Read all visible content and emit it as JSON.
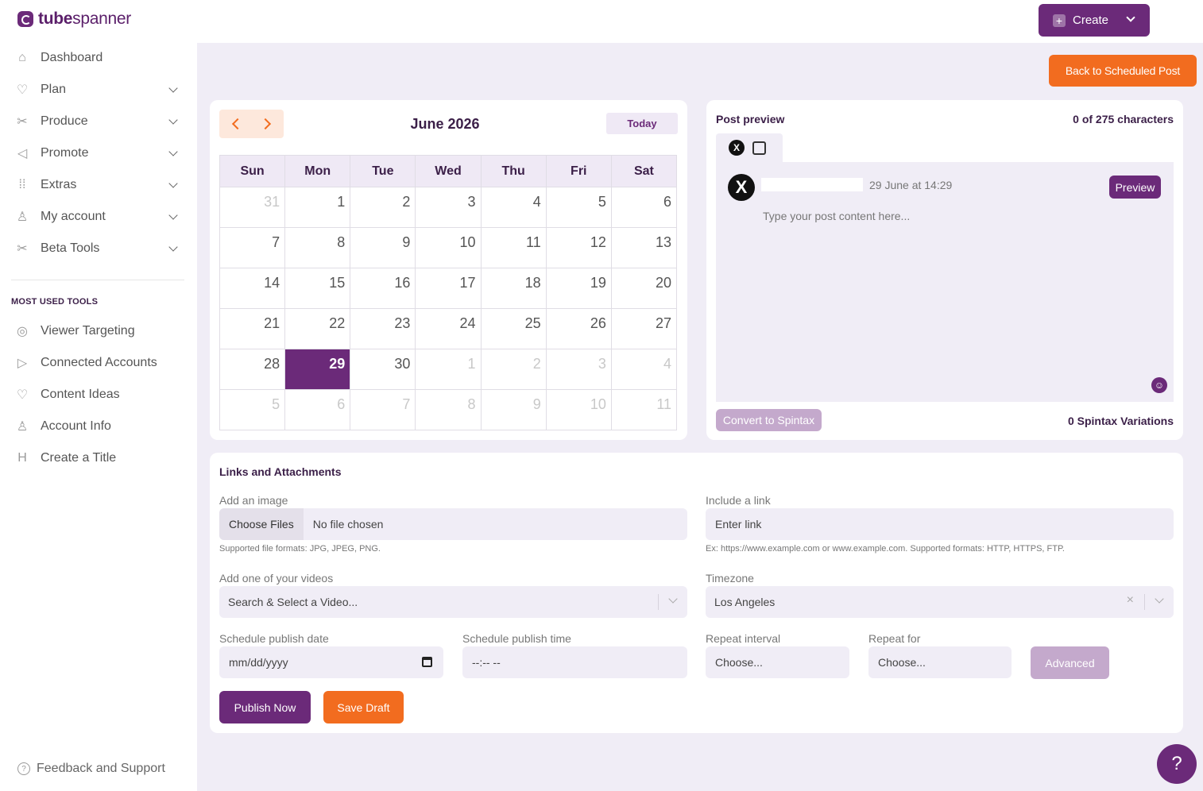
{
  "brand": {
    "name_bold": "tube",
    "name_rest": "spanner",
    "color": "#6b2a79",
    "accent": "#f26c1f"
  },
  "sidebar": {
    "items": [
      {
        "label": "Dashboard",
        "icon": "home-icon",
        "expandable": false
      },
      {
        "label": "Plan",
        "icon": "lightbulb-icon",
        "expandable": true
      },
      {
        "label": "Produce",
        "icon": "tools-icon",
        "expandable": true
      },
      {
        "label": "Promote",
        "icon": "megaphone-icon",
        "expandable": true
      },
      {
        "label": "Extras",
        "icon": "grid-dots-icon",
        "expandable": true
      },
      {
        "label": "My account",
        "icon": "user-gear-icon",
        "expandable": true
      },
      {
        "label": "Beta Tools",
        "icon": "tools-icon",
        "expandable": true
      }
    ],
    "most_used_title": "MOST USED TOOLS",
    "most_used": [
      {
        "label": "Viewer Targeting",
        "icon": "target-icon"
      },
      {
        "label": "Connected Accounts",
        "icon": "youtube-icon"
      },
      {
        "label": "Content Ideas",
        "icon": "lightbulb-icon"
      },
      {
        "label": "Account Info",
        "icon": "user-gear-icon"
      },
      {
        "label": "Create a Title",
        "icon": "heading-icon"
      }
    ],
    "feedback": "Feedback and Support"
  },
  "header": {
    "create_label": "Create"
  },
  "back_button": "Back to Scheduled Post",
  "calendar": {
    "title": "June 2026",
    "today_label": "Today",
    "weekdays": [
      "Sun",
      "Mon",
      "Tue",
      "Wed",
      "Thu",
      "Fri",
      "Sat"
    ],
    "weeks": [
      [
        {
          "d": "31",
          "m": true
        },
        {
          "d": "1"
        },
        {
          "d": "2"
        },
        {
          "d": "3"
        },
        {
          "d": "4"
        },
        {
          "d": "5"
        },
        {
          "d": "6"
        }
      ],
      [
        {
          "d": "7"
        },
        {
          "d": "8"
        },
        {
          "d": "9"
        },
        {
          "d": "10"
        },
        {
          "d": "11"
        },
        {
          "d": "12"
        },
        {
          "d": "13"
        }
      ],
      [
        {
          "d": "14"
        },
        {
          "d": "15"
        },
        {
          "d": "16"
        },
        {
          "d": "17"
        },
        {
          "d": "18"
        },
        {
          "d": "19"
        },
        {
          "d": "20"
        }
      ],
      [
        {
          "d": "21"
        },
        {
          "d": "22"
        },
        {
          "d": "23"
        },
        {
          "d": "24"
        },
        {
          "d": "25"
        },
        {
          "d": "26"
        },
        {
          "d": "27"
        }
      ],
      [
        {
          "d": "28"
        },
        {
          "d": "29",
          "s": true
        },
        {
          "d": "30"
        },
        {
          "d": "1",
          "m": true
        },
        {
          "d": "2",
          "m": true
        },
        {
          "d": "3",
          "m": true
        },
        {
          "d": "4",
          "m": true
        }
      ],
      [
        {
          "d": "5",
          "m": true
        },
        {
          "d": "6",
          "m": true
        },
        {
          "d": "7",
          "m": true
        },
        {
          "d": "8",
          "m": true
        },
        {
          "d": "9",
          "m": true
        },
        {
          "d": "10",
          "m": true
        },
        {
          "d": "11",
          "m": true
        }
      ]
    ]
  },
  "preview": {
    "title": "Post preview",
    "char_count": "0 of 275 characters",
    "date": "29 June at 14:29",
    "preview_button": "Preview",
    "placeholder": "Type your post content here...",
    "spintax_button": "Convert to Spintax",
    "spintax_count": "0 Spintax Variations"
  },
  "links": {
    "title": "Links and Attachments",
    "image_label": "Add an image",
    "choose_files": "Choose Files",
    "no_file": "No file chosen",
    "image_hint": "Supported file formats: JPG, JPEG, PNG.",
    "link_label": "Include a link",
    "link_placeholder": "Enter link",
    "link_hint": "Ex: https://www.example.com or www.example.com. Supported formats: HTTP, HTTPS, FTP.",
    "video_label": "Add one of your videos",
    "video_placeholder": "Search & Select a Video...",
    "timezone_label": "Timezone",
    "timezone_value": "Los Angeles",
    "date_label": "Schedule publish date",
    "date_placeholder": "mm/dd/yyyy",
    "time_label": "Schedule publish time",
    "time_placeholder": "--:-- --",
    "repeat_interval_label": "Repeat interval",
    "repeat_interval_value": "Choose...",
    "repeat_for_label": "Repeat for",
    "repeat_for_value": "Choose...",
    "advanced": "Advanced",
    "publish_now": "Publish Now",
    "save_draft": "Save Draft"
  },
  "help_icon": "?"
}
